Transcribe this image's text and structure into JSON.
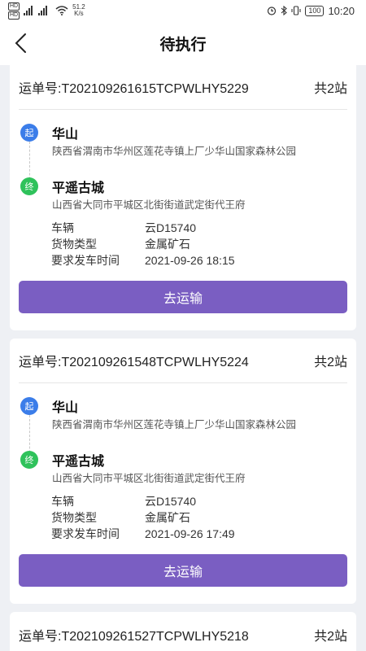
{
  "status_bar": {
    "left_tag_1": "HD",
    "left_tag_2": "HD",
    "net_speed_value": "51.2",
    "net_speed_unit": "K/s",
    "battery": "100",
    "time": "10:20"
  },
  "header": {
    "title": "待执行"
  },
  "colors": {
    "accent": "#7a5ec2",
    "start_dot": "#3b7de9",
    "end_dot": "#2fc25b"
  },
  "labels": {
    "order_prefix": "运单号:",
    "vehicle": "车辆",
    "cargo_type": "货物类型",
    "departure_time": "要求发车时间",
    "action_button": "去运输",
    "start_mark": "起",
    "end_mark": "终"
  },
  "orders": [
    {
      "order_no": "T202109261615TCPWLHY5229",
      "stations": "共2站",
      "start": {
        "name": "华山",
        "address": "陕西省渭南市华州区莲花寺镇上厂少华山国家森林公园"
      },
      "end": {
        "name": "平遥古城",
        "address": "山西省大同市平城区北街街道武定街代王府"
      },
      "vehicle": "云D15740",
      "cargo_type": "金属矿石",
      "departure_time": "2021-09-26 18:15"
    },
    {
      "order_no": "T202109261548TCPWLHY5224",
      "stations": "共2站",
      "start": {
        "name": "华山",
        "address": "陕西省渭南市华州区莲花寺镇上厂少华山国家森林公园"
      },
      "end": {
        "name": "平遥古城",
        "address": "山西省大同市平城区北街街道武定街代王府"
      },
      "vehicle": "云D15740",
      "cargo_type": "金属矿石",
      "departure_time": "2021-09-26 17:49"
    },
    {
      "order_no": "T202109261527TCPWLHY5218",
      "stations": "共2站"
    }
  ]
}
